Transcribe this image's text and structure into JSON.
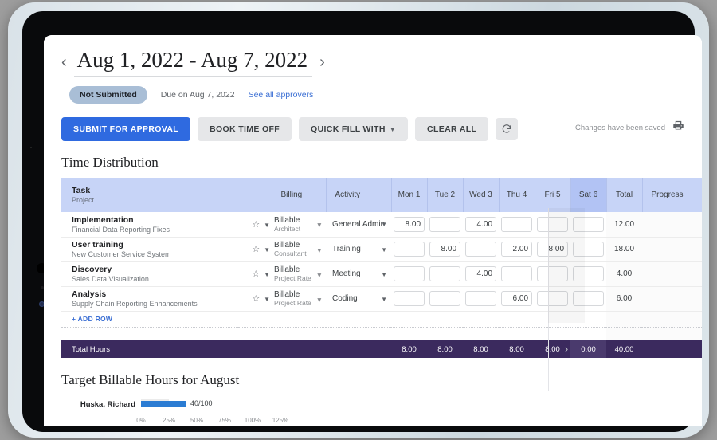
{
  "header": {
    "prev_icon": "chevron-left-icon",
    "next_icon": "chevron-right-icon",
    "date_range": "Aug 1, 2022 - Aug 7, 2022",
    "status_badge": "Not Submitted",
    "due_text": "Due on Aug 7, 2022",
    "approvers_link": "See all approvers"
  },
  "toolbar": {
    "submit_label": "SUBMIT FOR APPROVAL",
    "book_time_off_label": "BOOK TIME OFF",
    "quick_fill_label": "QUICK FILL WITH",
    "clear_all_label": "CLEAR ALL",
    "refresh_icon": "refresh-icon",
    "saved_text": "Changes have been saved",
    "print_icon": "printer-icon"
  },
  "time_distribution": {
    "section_title": "Time Distribution",
    "columns": {
      "task": "Task",
      "task_sub": "Project",
      "billing": "Billing",
      "activity": "Activity",
      "days": [
        "Mon 1",
        "Tue 2",
        "Wed 3",
        "Thu 4",
        "Fri 5",
        "Sat 6"
      ],
      "total": "Total",
      "progress": "Progress"
    },
    "rows": [
      {
        "task": "Implementation",
        "project": "Financial Data Reporting Fixes",
        "billing": "Billable",
        "rate": "Architect",
        "activity": "General Admin",
        "hours": [
          "8.00",
          "",
          "4.00",
          "",
          "",
          ""
        ],
        "total": "12.00"
      },
      {
        "task": "User training",
        "project": "New Customer Service System",
        "billing": "Billable",
        "rate": "Consultant",
        "activity": "Training",
        "hours": [
          "",
          "8.00",
          "",
          "2.00",
          "8.00",
          ""
        ],
        "total": "18.00"
      },
      {
        "task": "Discovery",
        "project": "Sales Data Visualization",
        "billing": "Billable",
        "rate": "Project Rate",
        "activity": "Meeting",
        "hours": [
          "",
          "",
          "4.00",
          "",
          "",
          ""
        ],
        "total": "4.00"
      },
      {
        "task": "Analysis",
        "project": "Supply Chain Reporting Enhancements",
        "billing": "Billable",
        "rate": "Project Rate",
        "activity": "Coding",
        "hours": [
          "",
          "",
          "",
          "6.00",
          "",
          ""
        ],
        "total": "6.00"
      }
    ],
    "add_row_label": "+ ADD ROW",
    "total_row": {
      "label": "Total Hours",
      "days": [
        "8.00",
        "8.00",
        "8.00",
        "8.00",
        "8.00",
        "0.00"
      ],
      "total": "40.00"
    },
    "row_icons": {
      "star": "star-outline-icon",
      "caret": "chevron-down-icon",
      "remove": "remove-circle-icon",
      "menu": "kebab-menu-icon"
    }
  },
  "chart_data": {
    "type": "bar",
    "title": "Target Billable Hours for August",
    "orientation": "horizontal",
    "categories": [
      "Huska, Richard"
    ],
    "values": [
      40
    ],
    "targets": [
      100
    ],
    "value_labels": [
      "40/100"
    ],
    "background_values": [
      25
    ],
    "xlabel": "",
    "ylabel": "",
    "xlim": [
      0,
      125
    ],
    "tick_labels": [
      "0%",
      "25%",
      "50%",
      "75%",
      "100%",
      "125%"
    ],
    "tick_values": [
      0,
      25,
      50,
      75,
      100,
      125
    ],
    "target_line": 100,
    "grid": false,
    "legend": "none",
    "colors": {
      "bar": "#2b7cd3",
      "track": "#ebebeb",
      "target_line": "#b9bcc0"
    }
  },
  "theme": {
    "primary": "#2f6ae0",
    "header_row": "#c7d4f7",
    "header_row_highlight": "#b2c3f4",
    "total_row": "#3b2a5e",
    "badge": "#a9bed6",
    "link": "#3b6fd4"
  }
}
